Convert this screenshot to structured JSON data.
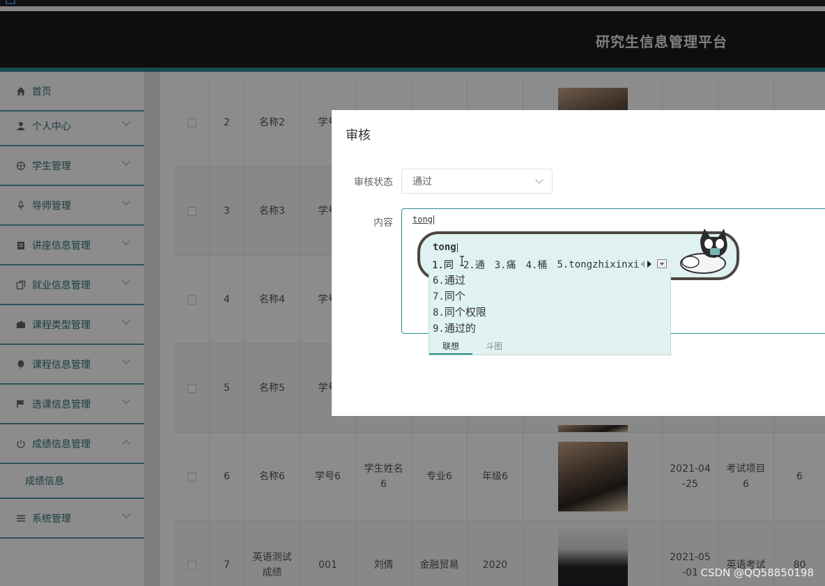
{
  "header": {
    "title": "研究生信息管理平台"
  },
  "sidebar": {
    "items": [
      {
        "label": "首页",
        "icon": "home-icon"
      },
      {
        "label": "个人中心",
        "icon": "user-icon"
      },
      {
        "label": "学生管理",
        "icon": "globe-icon"
      },
      {
        "label": "导师管理",
        "icon": "mic-icon"
      },
      {
        "label": "讲座信息管理",
        "icon": "clipboard-icon"
      },
      {
        "label": "就业信息管理",
        "icon": "copy-icon"
      },
      {
        "label": "课程类型管理",
        "icon": "wallet-icon"
      },
      {
        "label": "课程信息管理",
        "icon": "balloon-icon"
      },
      {
        "label": "选课信息管理",
        "icon": "flag-icon"
      },
      {
        "label": "成绩信息管理",
        "icon": "power-icon"
      },
      {
        "label": "系统管理",
        "icon": "list-icon"
      }
    ],
    "sub_item": "成绩信息"
  },
  "table": {
    "rows": [
      {
        "id": "2",
        "name": "名称2",
        "num": "学号",
        "student": "",
        "major": "",
        "grade": "",
        "date": "",
        "project": "",
        "score": ""
      },
      {
        "id": "3",
        "name": "名称3",
        "num": "学号",
        "student": "",
        "major": "",
        "grade": "",
        "date": "",
        "project": "",
        "score": ""
      },
      {
        "id": "4",
        "name": "名称4",
        "num": "学号",
        "student": "",
        "major": "",
        "grade": "",
        "date": "",
        "project": "",
        "score": ""
      },
      {
        "id": "5",
        "name": "名称5",
        "num": "学号",
        "student": "",
        "major": "",
        "grade": "",
        "date": "",
        "project": "",
        "score": ""
      },
      {
        "id": "6",
        "name": "名称6",
        "num": "学号6",
        "student": "学生姓名6",
        "major": "专业6",
        "grade": "年级6",
        "date": "2021-04-25",
        "project": "考试项目6",
        "score": "6"
      },
      {
        "id": "7",
        "name": "英语测试成绩",
        "num": "001",
        "student": "刘倩",
        "major": "金融贸易",
        "grade": "2020",
        "date": "2021-05-01",
        "project": "英语考试",
        "score": "80"
      }
    ]
  },
  "dialog": {
    "title": "审核",
    "status_label": "审核状态",
    "status_value": "通过",
    "content_label": "内容",
    "content_value": "tong"
  },
  "ime": {
    "pinyin": "tong",
    "candidates": [
      "1.同",
      "2.通",
      "3.痛",
      "4.桶",
      "5.tongzhixinxi"
    ],
    "list": [
      {
        "n": "6.",
        "t": "通过"
      },
      {
        "n": "7.",
        "t": "同个"
      },
      {
        "n": "8.",
        "t": "同个权限"
      },
      {
        "n": "9.",
        "t": "通过的"
      }
    ],
    "tabs": [
      "联想",
      "斗图"
    ]
  },
  "watermark": "CSDN @QQ58850198",
  "colors": {
    "accent": "#2d8a8f",
    "header_bg": "#1a1a1a"
  }
}
